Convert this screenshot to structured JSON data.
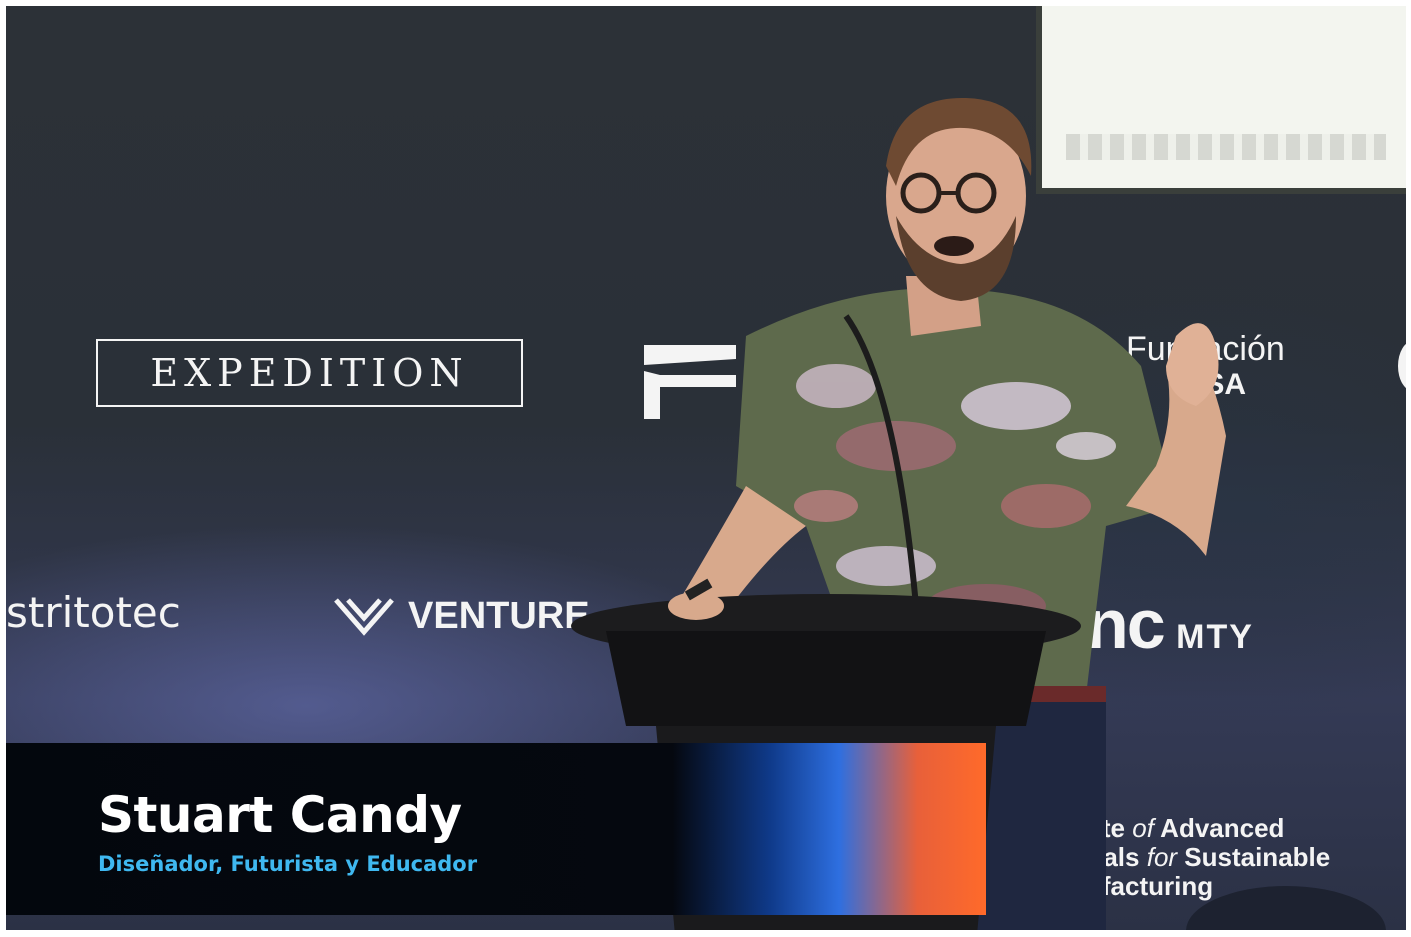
{
  "scene": {
    "logos": {
      "expedition": "EXPEDITION",
      "fundacion": "Fundación",
      "fundacion_sub": "ISA",
      "distritotec": "stritotec",
      "venture": "VENTURE",
      "inc": "nc",
      "inc_mty": "MTY",
      "institute_line1_a": "ute ",
      "institute_line1_b": "of",
      "institute_line1_c": " Advanced",
      "institute_line2_a": "rials ",
      "institute_line2_b": "for",
      "institute_line2_c": " Sustainable",
      "institute_line3": "ufacturing"
    }
  },
  "lower_third": {
    "name": "Stuart Candy",
    "role": "Diseñador, Futurista y Educador"
  },
  "colors": {
    "lower_third_bg": "#05080f",
    "role_text": "#3fb8f0",
    "gradient_blue": "#2e6fe0",
    "gradient_orange": "#ff6a2a"
  }
}
